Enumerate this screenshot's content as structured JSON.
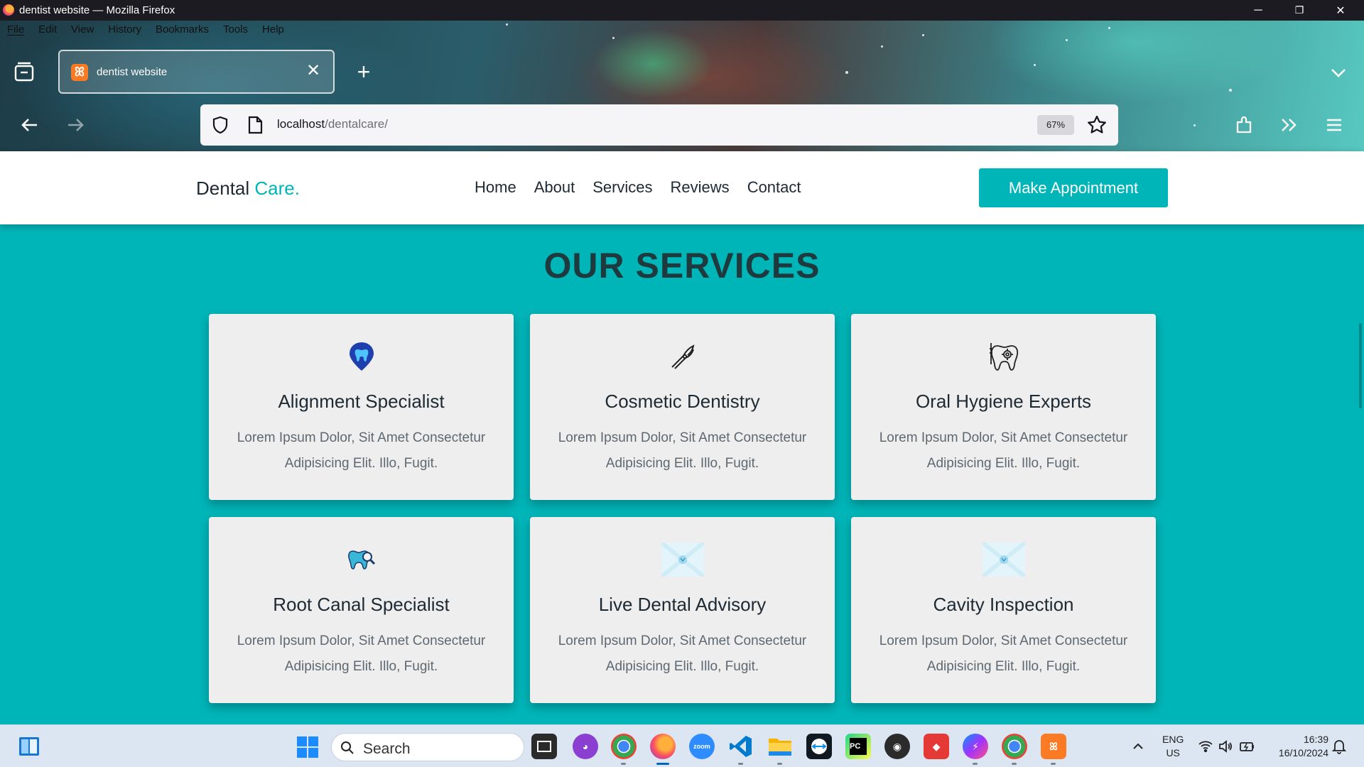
{
  "window": {
    "title": "dentist website — Mozilla Firefox",
    "controls": {
      "minimize": "─",
      "restore": "❐",
      "close": "✕"
    }
  },
  "menubar": [
    "File",
    "Edit",
    "View",
    "History",
    "Bookmarks",
    "Tools",
    "Help"
  ],
  "tab": {
    "title": "dentist website",
    "favicon_letter": "ꕤ",
    "close": "✕"
  },
  "new_tab": "+",
  "urlbar": {
    "host": "localhost",
    "path": "/dentalcare/",
    "zoom": "67%"
  },
  "site": {
    "logo": {
      "text": "Dental",
      "accent": "Care."
    },
    "nav": [
      "Home",
      "About",
      "Services",
      "Reviews",
      "Contact"
    ],
    "cta": "Make Appointment",
    "section_title": "OUR SERVICES",
    "services": [
      {
        "title": "Alignment Specialist",
        "text": "Lorem Ipsum Dolor, Sit Amet Consectetur Adipisicing Elit. Illo, Fugit.",
        "icon": "tooth-pin-icon"
      },
      {
        "title": "Cosmetic Dentistry",
        "text": "Lorem Ipsum Dolor, Sit Amet Consectetur Adipisicing Elit. Illo, Fugit.",
        "icon": "dental-pliers-icon"
      },
      {
        "title": "Oral Hygiene Experts",
        "text": "Lorem Ipsum Dolor, Sit Amet Consectetur Adipisicing Elit. Illo, Fugit.",
        "icon": "tooth-gear-icon"
      },
      {
        "title": "Root Canal Specialist",
        "text": "Lorem Ipsum Dolor, Sit Amet Consectetur Adipisicing Elit. Illo, Fugit.",
        "icon": "tooth-magnifier-icon"
      },
      {
        "title": "Live Dental Advisory",
        "text": "Lorem Ipsum Dolor, Sit Amet Consectetur Adipisicing Elit. Illo, Fugit.",
        "icon": "advisory-image-icon"
      },
      {
        "title": "Cavity Inspection",
        "text": "Lorem Ipsum Dolor, Sit Amet Consectetur Adipisicing Elit. Illo, Fugit.",
        "icon": "inspection-image-icon"
      }
    ]
  },
  "taskbar": {
    "search_placeholder": "Search",
    "lang": {
      "line1": "ENG",
      "line2": "US"
    },
    "clock": {
      "time": "16:39",
      "date": "16/10/2024"
    }
  },
  "colors": {
    "accent": "#00b5b8",
    "heading": "#1e3a3e",
    "card": "#eeeeef"
  }
}
